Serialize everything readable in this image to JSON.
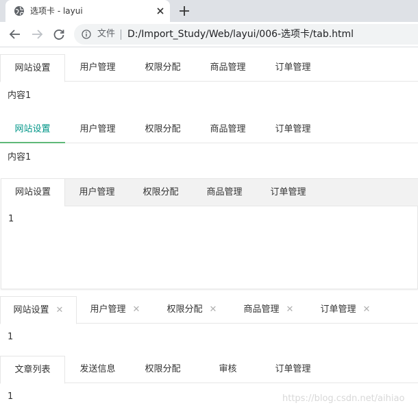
{
  "browser": {
    "tab_title": "选项卡 - layui",
    "scheme_label": "文件",
    "url": "D:/Import_Study/Web/layui/006-选项卡/tab.html"
  },
  "tabs_brief": {
    "items": [
      "网站设置",
      "用户管理",
      "权限分配",
      "商品管理",
      "订单管理"
    ],
    "selected": 0,
    "content": "内容1"
  },
  "tabs_green": {
    "items": [
      "网站设置",
      "用户管理",
      "权限分配",
      "商品管理",
      "订单管理"
    ],
    "selected": 0,
    "content": "内容1"
  },
  "tabs_card": {
    "items": [
      "网站设置",
      "用户管理",
      "权限分配",
      "商品管理",
      "订单管理"
    ],
    "selected": 0,
    "content": "1"
  },
  "tabs_closable": {
    "items": [
      "网站设置",
      "用户管理",
      "权限分配",
      "商品管理",
      "订单管理"
    ],
    "selected": 0,
    "close_glyph": "✕",
    "content": "1"
  },
  "tabs_last": {
    "items": [
      "文章列表",
      "发送信息",
      "权限分配",
      "审核",
      "订单管理"
    ],
    "selected": 0,
    "content": "1"
  },
  "watermark": "https://blog.csdn.net/aihiao",
  "colors": {
    "accent_green": "#009688",
    "underline_green": "#5fb878",
    "border": "#e6e6e6"
  }
}
